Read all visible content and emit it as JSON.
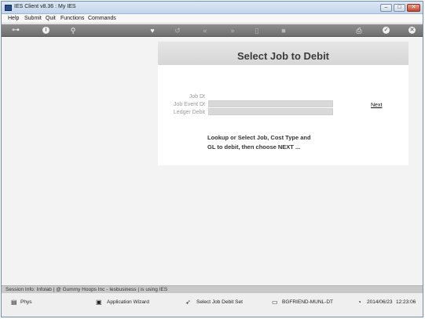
{
  "window": {
    "title": "IES Client v8.36 : My IES",
    "controls": {
      "minimize": "–",
      "maximize": "□",
      "close": "✕"
    }
  },
  "menu": {
    "items": [
      "Help",
      "Submit",
      "Quit",
      "Functions",
      "Commands"
    ]
  },
  "toolbar": {
    "icons": [
      "key-icon",
      "info-icon",
      "search-icon",
      "heart-icon",
      "undo-icon",
      "rewind-icon",
      "forward-icon",
      "trash-icon",
      "square-icon",
      "print-icon",
      "check-icon",
      "close-icon"
    ]
  },
  "form": {
    "title": "Select Job to Debit",
    "fields": [
      {
        "label": "Job Dt",
        "value": ""
      },
      {
        "label": "Job Event Dt",
        "value": ""
      },
      {
        "label": "Ledger Debit",
        "value": ""
      }
    ],
    "next_link": "Next",
    "instruction_line1": "Lookup or Select Job, Cost Type and",
    "instruction_line2": "GL to debit, then choose NEXT ..."
  },
  "status": {
    "session": "Session Info: Infolab | @ Gummy Hoops Inc   - Iesbusiness | is using IES"
  },
  "taskbar": {
    "items": [
      {
        "label": "Phys",
        "icon": "document-icon"
      },
      {
        "label": "Application Wizard",
        "icon": "wizard-icon"
      },
      {
        "label": "Select Job Debit Set",
        "icon": "pointer-icon"
      },
      {
        "label": "BGFRIEND-MUNL-DT",
        "icon": "computer-icon"
      },
      {
        "label": "2014/06/23",
        "icon": "clock-icon"
      },
      {
        "label": "12:23:06",
        "icon": ""
      }
    ]
  }
}
